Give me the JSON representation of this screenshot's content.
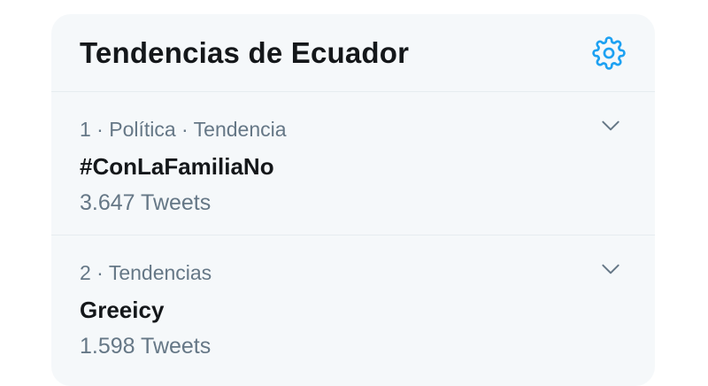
{
  "header": {
    "title": "Tendencias de Ecuador",
    "settings_icon": "gear-icon"
  },
  "trends": [
    {
      "meta": "1 · Política · Tendencia",
      "name": "#ConLaFamiliaNo",
      "count": "3.647 Tweets"
    },
    {
      "meta": "2 · Tendencias",
      "name": "Greeicy",
      "count": "1.598 Tweets"
    }
  ],
  "colors": {
    "accent": "#1da1f2",
    "panel_bg": "#f5f8fa",
    "secondary_text": "#657786",
    "primary_text": "#14171a"
  }
}
